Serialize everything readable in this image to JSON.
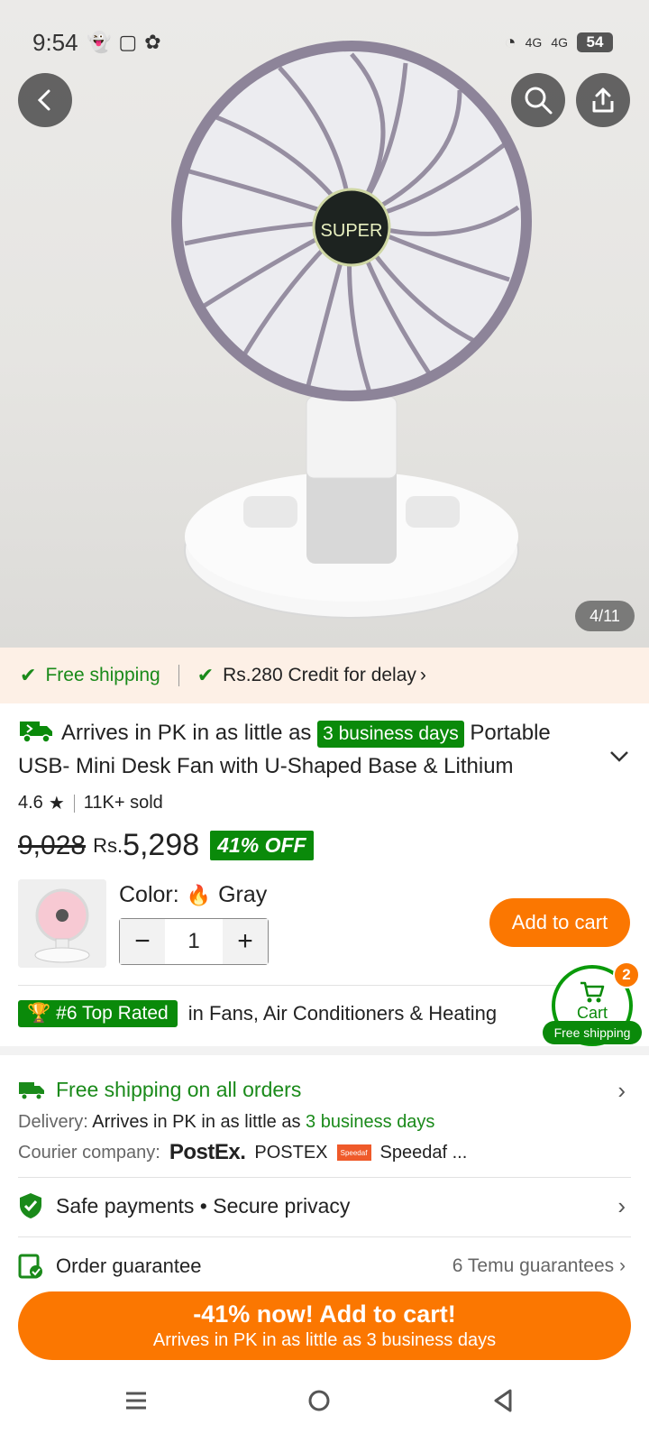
{
  "status": {
    "time": "9:54",
    "battery": "54",
    "network_1": "4G",
    "network_2": "4G"
  },
  "hero": {
    "logo_text": "SUPER",
    "image_counter": "4/11"
  },
  "shipping_banner": {
    "free_shipping": "Free shipping",
    "credit": "Rs.280 Credit for delay"
  },
  "product": {
    "arrives_prefix": "Arrives in PK in as little as",
    "arrives_badge": "3 business days",
    "title_line1_rest": "Portable",
    "title_line2": "USB- Mini Desk Fan with U-Shaped Base & Lithium",
    "rating": "4.6",
    "sold": "11K+ sold",
    "old_price": "9,028",
    "currency": "Rs.",
    "price": "5,298",
    "discount": "41% OFF",
    "color_label": "Color:",
    "color_value": "Gray",
    "quantity": "1",
    "add_to_cart": "Add to cart"
  },
  "top_rated": {
    "badge": "#6 Top Rated",
    "category": "in Fans, Air Conditioners & Heating"
  },
  "cart": {
    "count": "2",
    "label": "Cart",
    "free_shipping": "Free shipping"
  },
  "shipping_info": {
    "title": "Free shipping on all orders",
    "delivery_label": "Delivery:",
    "delivery_text": "Arrives in PK in as little as",
    "delivery_days": "3 business days",
    "courier_label": "Courier company:",
    "postex_logo": "PostEx.",
    "postex_name": "POSTEX",
    "speedaf_logo": "Speedaf",
    "speedaf_name": "Speedaf ..."
  },
  "safe": {
    "label": "Safe payments • Secure privacy"
  },
  "guarantee": {
    "label": "Order guarantee",
    "count": "6 Temu guarantees"
  },
  "cta": {
    "main": "-41% now! Add to cart!",
    "sub": "Arrives in PK in as little as 3 business days"
  },
  "colors": {
    "accent_orange": "#fb7701",
    "green": "#0a8a0a",
    "banner_bg": "#fdf0e6"
  }
}
